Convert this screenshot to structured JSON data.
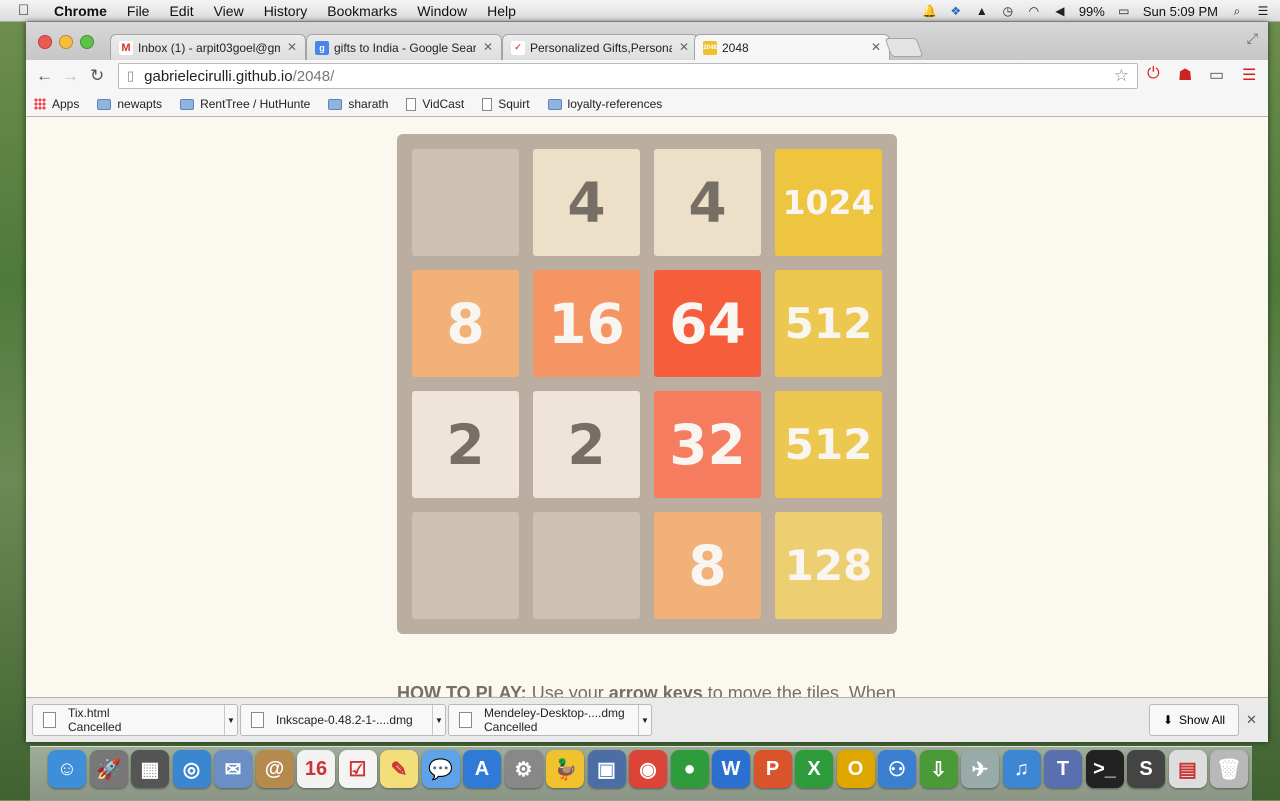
{
  "menubar": {
    "app": "Chrome",
    "items": [
      "File",
      "Edit",
      "View",
      "History",
      "Bookmarks",
      "Window",
      "Help"
    ],
    "battery": "99%",
    "clock": "Sun 5:09 PM"
  },
  "tabs": [
    {
      "label": "Inbox (1) - arpit03goel@gm",
      "favicon": "gmail-icon",
      "color": "#d93025",
      "glyph": "M"
    },
    {
      "label": "gifts to India - Google Sear",
      "favicon": "google-icon",
      "color": "#4a86e8",
      "glyph": "g"
    },
    {
      "label": "Personalized Gifts,Persona",
      "favicon": "gift-site-icon",
      "color": "#e24b3c",
      "glyph": "✓"
    },
    {
      "label": "2048",
      "favicon": "2048-icon",
      "color": "#edc22e",
      "glyph": "2048"
    }
  ],
  "address": {
    "host": "gabrielecirulli.github.io",
    "path": "/2048/"
  },
  "bookmarks": [
    {
      "label": "Apps",
      "type": "apps"
    },
    {
      "label": "newapts",
      "type": "folder"
    },
    {
      "label": "RentTree / HutHunte",
      "type": "folder"
    },
    {
      "label": "sharath",
      "type": "folder"
    },
    {
      "label": "VidCast",
      "type": "page"
    },
    {
      "label": "Squirt",
      "type": "page"
    },
    {
      "label": "loyalty-references",
      "type": "folder"
    }
  ],
  "board": {
    "rows": [
      [
        "",
        "4",
        "4",
        "1024"
      ],
      [
        "8",
        "16",
        "64",
        "512"
      ],
      [
        "2",
        "2",
        "32",
        "512"
      ],
      [
        "",
        "",
        "8",
        "128"
      ]
    ]
  },
  "howto": {
    "lead": "HOW TO PLAY:",
    "text1": " Use your ",
    "keys": "arrow keys",
    "text2": " to move the tiles. When"
  },
  "downloads": [
    {
      "name": "Tix.html",
      "status": "Cancelled"
    },
    {
      "name": "Inkscape-0.48.2-1-....dmg",
      "status": ""
    },
    {
      "name": "Mendeley-Desktop-....dmg",
      "status": "Cancelled"
    }
  ],
  "show_all": "Show All",
  "dock": [
    {
      "name": "finder-icon",
      "color": "#3f8fd8",
      "glyph": "☺"
    },
    {
      "name": "launchpad-icon",
      "color": "#777",
      "glyph": "🚀"
    },
    {
      "name": "mission-control-icon",
      "color": "#555",
      "glyph": "▦"
    },
    {
      "name": "safari-icon",
      "color": "#3a87d0",
      "glyph": "◎"
    },
    {
      "name": "mail-icon",
      "color": "#6b8fc4",
      "glyph": "✉"
    },
    {
      "name": "contacts-icon",
      "color": "#b58a4e",
      "glyph": "@"
    },
    {
      "name": "calendar-icon",
      "color": "#f2f2f2",
      "glyph": "16"
    },
    {
      "name": "reminders-icon",
      "color": "#f4f4f4",
      "glyph": "☑"
    },
    {
      "name": "notes-icon",
      "color": "#f3df7a",
      "glyph": "✎"
    },
    {
      "name": "messages-icon",
      "color": "#5ea3e8",
      "glyph": "💬"
    },
    {
      "name": "app-store-icon",
      "color": "#2f7ad6",
      "glyph": "A"
    },
    {
      "name": "system-preferences-icon",
      "color": "#888",
      "glyph": "⚙"
    },
    {
      "name": "cyberduck-icon",
      "color": "#f2c12e",
      "glyph": "🦆"
    },
    {
      "name": "iphoto-icon",
      "color": "#4b6ea5",
      "glyph": "▣"
    },
    {
      "name": "chrome-icon",
      "color": "#db4437",
      "glyph": "◉"
    },
    {
      "name": "facetime-icon",
      "color": "#2e9b3c",
      "glyph": "●"
    },
    {
      "name": "word-icon",
      "color": "#2b6fd0",
      "glyph": "W"
    },
    {
      "name": "powerpoint-icon",
      "color": "#d9532b",
      "glyph": "P"
    },
    {
      "name": "excel-icon",
      "color": "#2e9b3c",
      "glyph": "X"
    },
    {
      "name": "outlook-icon",
      "color": "#e0a600",
      "glyph": "O"
    },
    {
      "name": "lync-icon",
      "color": "#3a7fd0",
      "glyph": "⚇"
    },
    {
      "name": "downloader-icon",
      "color": "#4a9a3a",
      "glyph": "⇩"
    },
    {
      "name": "satellite-icon",
      "color": "#9aa",
      "glyph": "✈"
    },
    {
      "name": "itunes-icon",
      "color": "#3d86d3",
      "glyph": "♫"
    },
    {
      "name": "textwrangler-icon",
      "color": "#5a6fb0",
      "glyph": "T"
    },
    {
      "name": "terminal-icon",
      "color": "#222",
      "glyph": ">_"
    },
    {
      "name": "sublime-icon",
      "color": "#444",
      "glyph": "S"
    },
    {
      "name": "documents-stack-icon",
      "color": "#ddd",
      "glyph": "▤"
    },
    {
      "name": "trash-icon",
      "color": "#b8b8b8",
      "glyph": "🗑"
    }
  ]
}
